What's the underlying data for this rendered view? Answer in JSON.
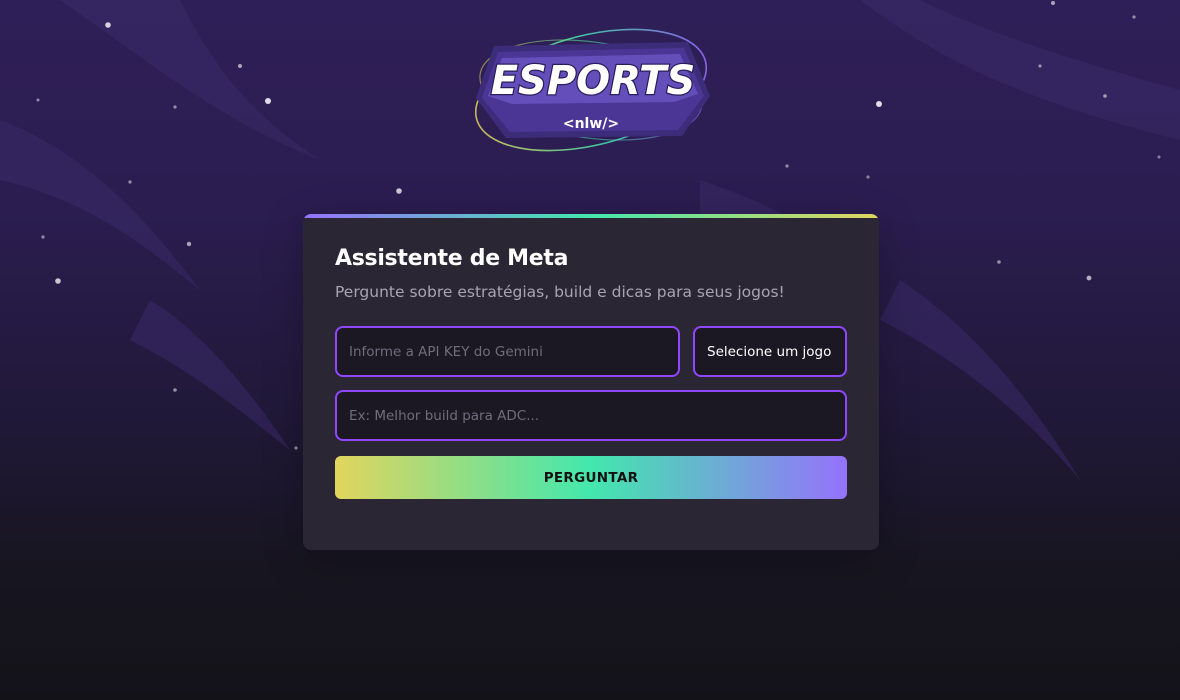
{
  "logo": {
    "wordmark": "ESPORTS",
    "tag": "<nlw/>"
  },
  "card": {
    "title": "Assistente de Meta",
    "subtitle": "Pergunte sobre estratégias, build e dicas para seus jogos!",
    "api_key": {
      "value": "",
      "placeholder": "Informe a API KEY do Gemini"
    },
    "game_select": {
      "selected": "Selecione um jogo"
    },
    "question": {
      "value": "",
      "placeholder": "Ex: Melhor build para ADC..."
    },
    "ask_button": "PERGUNTAR"
  },
  "colors": {
    "accent_purple": "#9147ff",
    "gradient_yellow": "#e1d55d",
    "gradient_green": "#43e7ad",
    "gradient_violet": "#9572fc",
    "card_background": "#2a2634"
  }
}
